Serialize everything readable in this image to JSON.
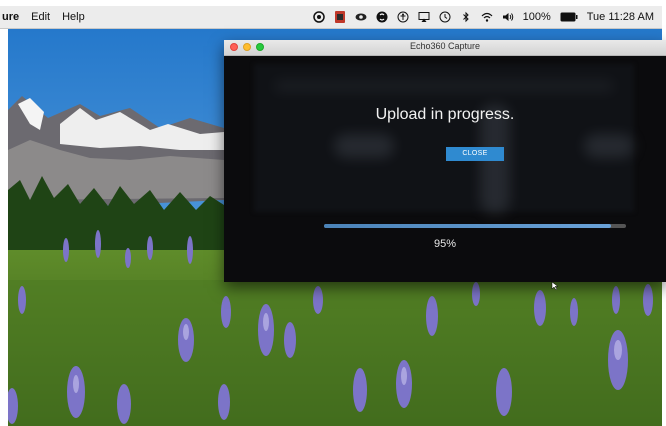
{
  "menubar": {
    "app_name": "ure",
    "menus": [
      "Edit",
      "Help"
    ],
    "battery": "100%",
    "clock": "Tue 11:28 AM",
    "icons": [
      "record-icon",
      "red-app-icon",
      "eye-icon",
      "shazam-icon",
      "accessibility-icon",
      "airplay-icon",
      "time-machine-icon",
      "bluetooth-icon",
      "wifi-icon",
      "volume-icon",
      "battery-icon"
    ]
  },
  "window": {
    "title": "Echo360 Capture",
    "message": "Upload in progress.",
    "close_button": "CLOSE",
    "progress_label": "95%",
    "progress_fraction": 0.95
  },
  "colors": {
    "accent_button": "#2f8ad0",
    "progress_fill": "#5b93c8",
    "window_bg": "#0b0b0d"
  }
}
